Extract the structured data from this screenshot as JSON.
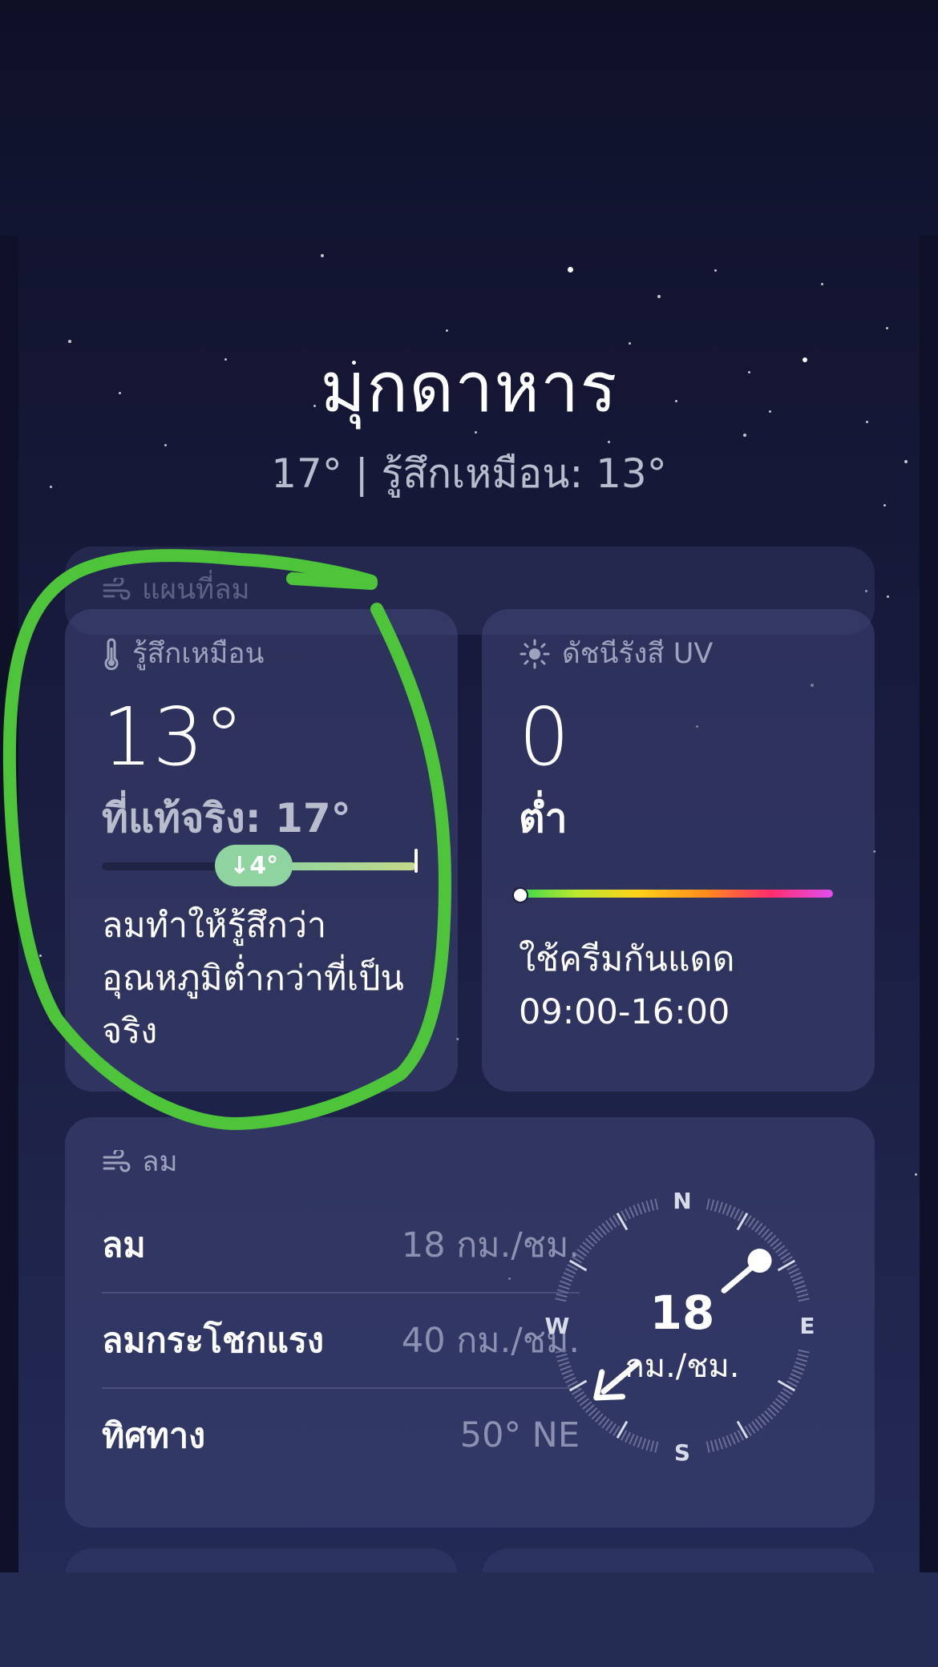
{
  "location": {
    "city": "มุกดาหาร",
    "summary": "17° | รู้สึกเหมือน: 13°"
  },
  "wind_map": {
    "title": "แผนที่ลม",
    "icon": "wind-icon"
  },
  "feels_like": {
    "title": "รู้สึกเหมือน",
    "icon": "thermometer-icon",
    "value": "13°",
    "actual": "ที่แท้จริง: 17°",
    "difference": "↓4°",
    "description": "ลมทำให้รู้สึกว่าอุณหภูมิต่ำกว่าที่เป็นจริง",
    "colors": {
      "fill_start": "#8fd4a0",
      "fill_end": "#c4d98a"
    }
  },
  "uv": {
    "title": "ดัชนีรังสี UV",
    "icon": "sun-icon",
    "value": "0",
    "level": "ต่ำ",
    "description": "ใช้ครีมกันแดด 09:00-16:00",
    "marker_fraction": 0
  },
  "wind": {
    "title": "ลม",
    "icon": "wind-icon",
    "rows": [
      {
        "label": "ลม",
        "value": "18 กม./ชม."
      },
      {
        "label": "ลมกระโชกแรง",
        "value": "40 กม./ชม."
      },
      {
        "label": "ทิศทาง",
        "value": "50° NE"
      }
    ],
    "compass": {
      "speed": "18",
      "unit": "กม./ชม.",
      "north": "N",
      "east": "E",
      "south": "S",
      "west": "W",
      "direction_deg": 50
    }
  },
  "annotation": {
    "color": "#4ec43a"
  }
}
